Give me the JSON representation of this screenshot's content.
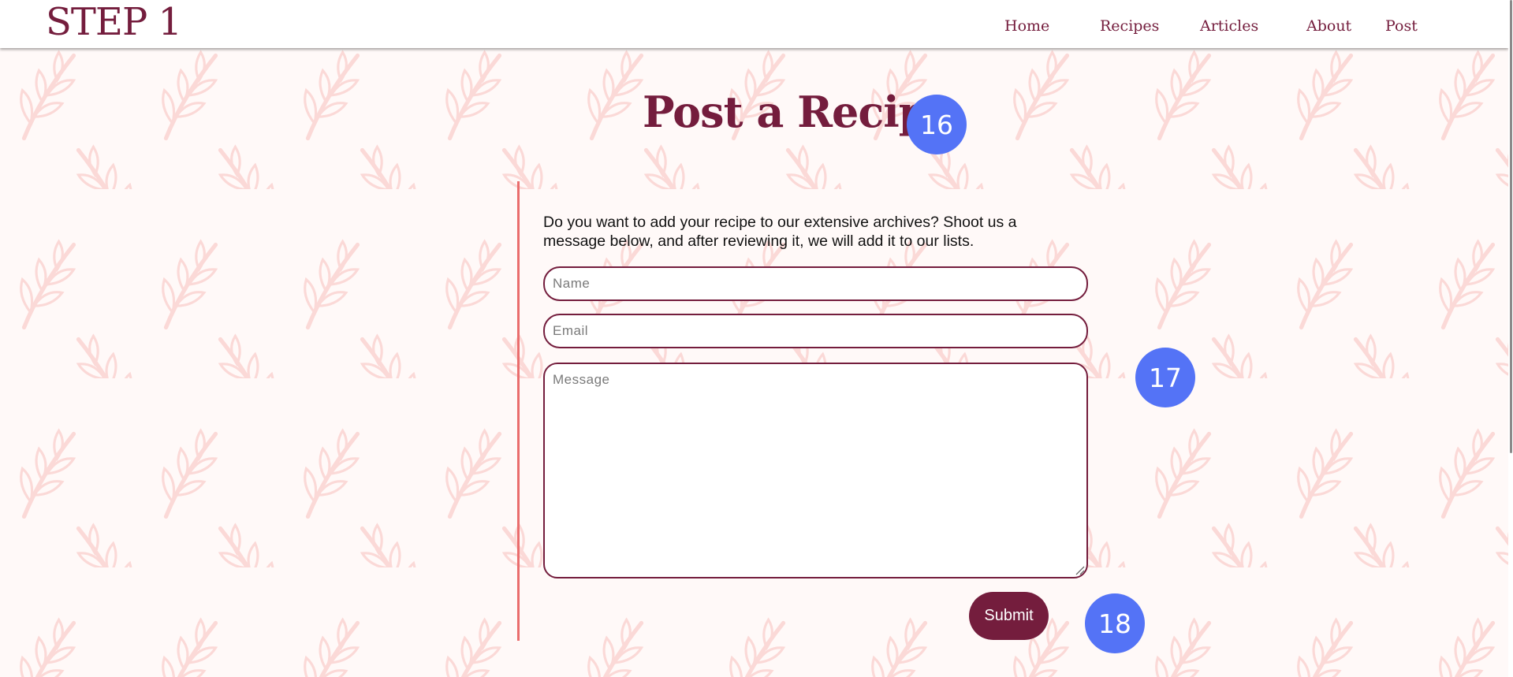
{
  "brand": {
    "logo_text": "STEP 1",
    "primary_color": "#741d3d",
    "accent_line_color": "#ea6d6d",
    "pattern_leaf_color": "#fbd9d7",
    "background_color": "#fff9f8",
    "badge_color": "#5473f6"
  },
  "nav": {
    "items": [
      {
        "label": "Home"
      },
      {
        "label": "Recipes"
      },
      {
        "label": "Articles"
      },
      {
        "label": "About"
      },
      {
        "label": "Post"
      }
    ]
  },
  "page": {
    "title": "Post a Recipe",
    "intro_text": "Do you want to add your recipe to our extensive archives? Shoot us a message below, and after reviewing it, we will add it to our lists."
  },
  "form": {
    "name_placeholder": "Name",
    "email_placeholder": "Email",
    "message_placeholder": "Message",
    "name_value": "",
    "email_value": "",
    "message_value": "",
    "submit_label": "Submit"
  },
  "badges": [
    "16",
    "17",
    "18"
  ]
}
